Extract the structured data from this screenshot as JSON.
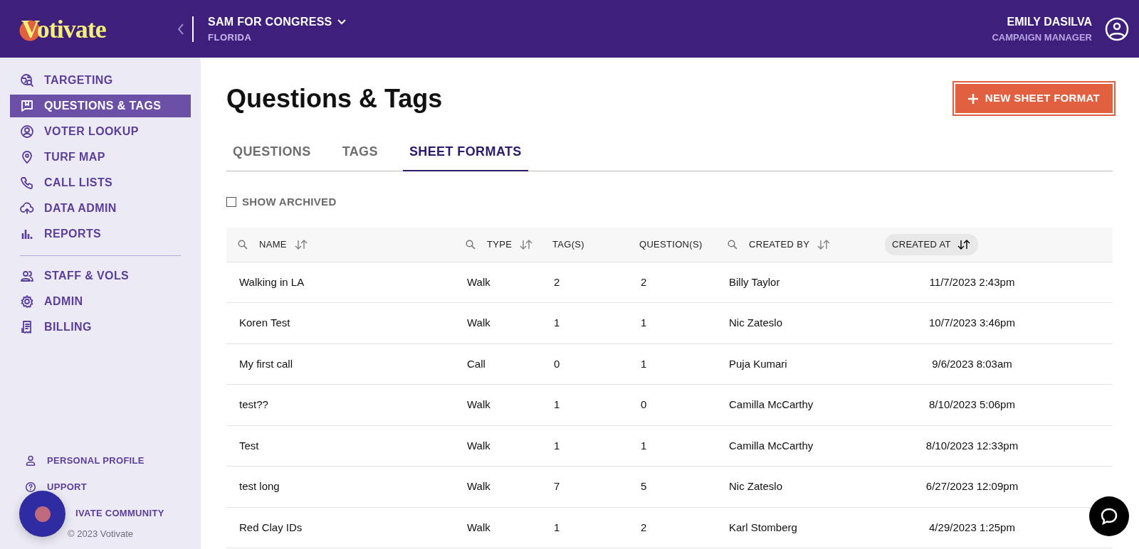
{
  "header": {
    "logo": "Votivate",
    "campaign": "SAM FOR CONGRESS",
    "state": "FLORIDA",
    "user_name": "EMILY DASILVA",
    "user_role": "CAMPAIGN MANAGER"
  },
  "sidebar": {
    "groups": [
      {
        "items": [
          {
            "label": "TARGETING",
            "selected": false
          },
          {
            "label": "QUESTIONS & TAGS",
            "selected": true
          },
          {
            "label": "VOTER LOOKUP",
            "selected": false
          },
          {
            "label": "TURF MAP",
            "selected": false
          },
          {
            "label": "CALL LISTS",
            "selected": false
          },
          {
            "label": "DATA ADMIN",
            "selected": false
          },
          {
            "label": "REPORTS",
            "selected": false
          }
        ]
      },
      {
        "items": [
          {
            "label": "STAFF & VOLS",
            "selected": false
          },
          {
            "label": "ADMIN",
            "selected": false
          },
          {
            "label": "BILLING",
            "selected": false
          }
        ]
      }
    ],
    "footer_links": [
      {
        "label": "PERSONAL PROFILE"
      },
      {
        "label": "UPPORT"
      },
      {
        "label": "IVATE COMMUNITY"
      }
    ],
    "copyright": "© 2023 Votivate"
  },
  "page": {
    "title": "Questions & Tags",
    "action_button": "NEW SHEET FORMAT",
    "tabs": [
      {
        "label": "QUESTIONS",
        "selected": false
      },
      {
        "label": "TAGS",
        "selected": false
      },
      {
        "label": "SHEET FORMATS",
        "selected": true
      }
    ],
    "show_archived": {
      "label": "SHOW ARCHIVED",
      "checked": false
    }
  },
  "table": {
    "columns": [
      {
        "label": "NAME",
        "searchable": true,
        "sortable": true,
        "sorted": false
      },
      {
        "label": "TYPE",
        "searchable": true,
        "sortable": true,
        "sorted": false
      },
      {
        "label": "TAG(S)",
        "searchable": false,
        "sortable": false,
        "sorted": false
      },
      {
        "label": "QUESTION(S)",
        "searchable": false,
        "sortable": false,
        "sorted": false
      },
      {
        "label": "CREATED BY",
        "searchable": true,
        "sortable": true,
        "sorted": false
      },
      {
        "label": "CREATED AT",
        "searchable": false,
        "sortable": true,
        "sorted": true
      }
    ],
    "rows": [
      [
        "Walking in LA",
        "Walk",
        "2",
        "2",
        "Billy Taylor",
        "11/7/2023 2:43pm"
      ],
      [
        "Koren Test",
        "Walk",
        "1",
        "1",
        "Nic Zateslo",
        "10/7/2023 3:46pm"
      ],
      [
        "My first call",
        "Call",
        "0",
        "1",
        "Puja Kumari",
        "9/6/2023 8:03am"
      ],
      [
        "test??",
        "Walk",
        "1",
        "0",
        "Camilla McCarthy",
        "8/10/2023 5:06pm"
      ],
      [
        "Test",
        "Walk",
        "1",
        "1",
        "Camilla McCarthy",
        "8/10/2023 12:33pm"
      ],
      [
        "test long",
        "Walk",
        "7",
        "5",
        "Nic Zateslo",
        "6/27/2023 12:09pm"
      ],
      [
        "Red Clay IDs",
        "Walk",
        "1",
        "2",
        "Karl Stomberg",
        "4/29/2023 1:25pm"
      ]
    ]
  }
}
